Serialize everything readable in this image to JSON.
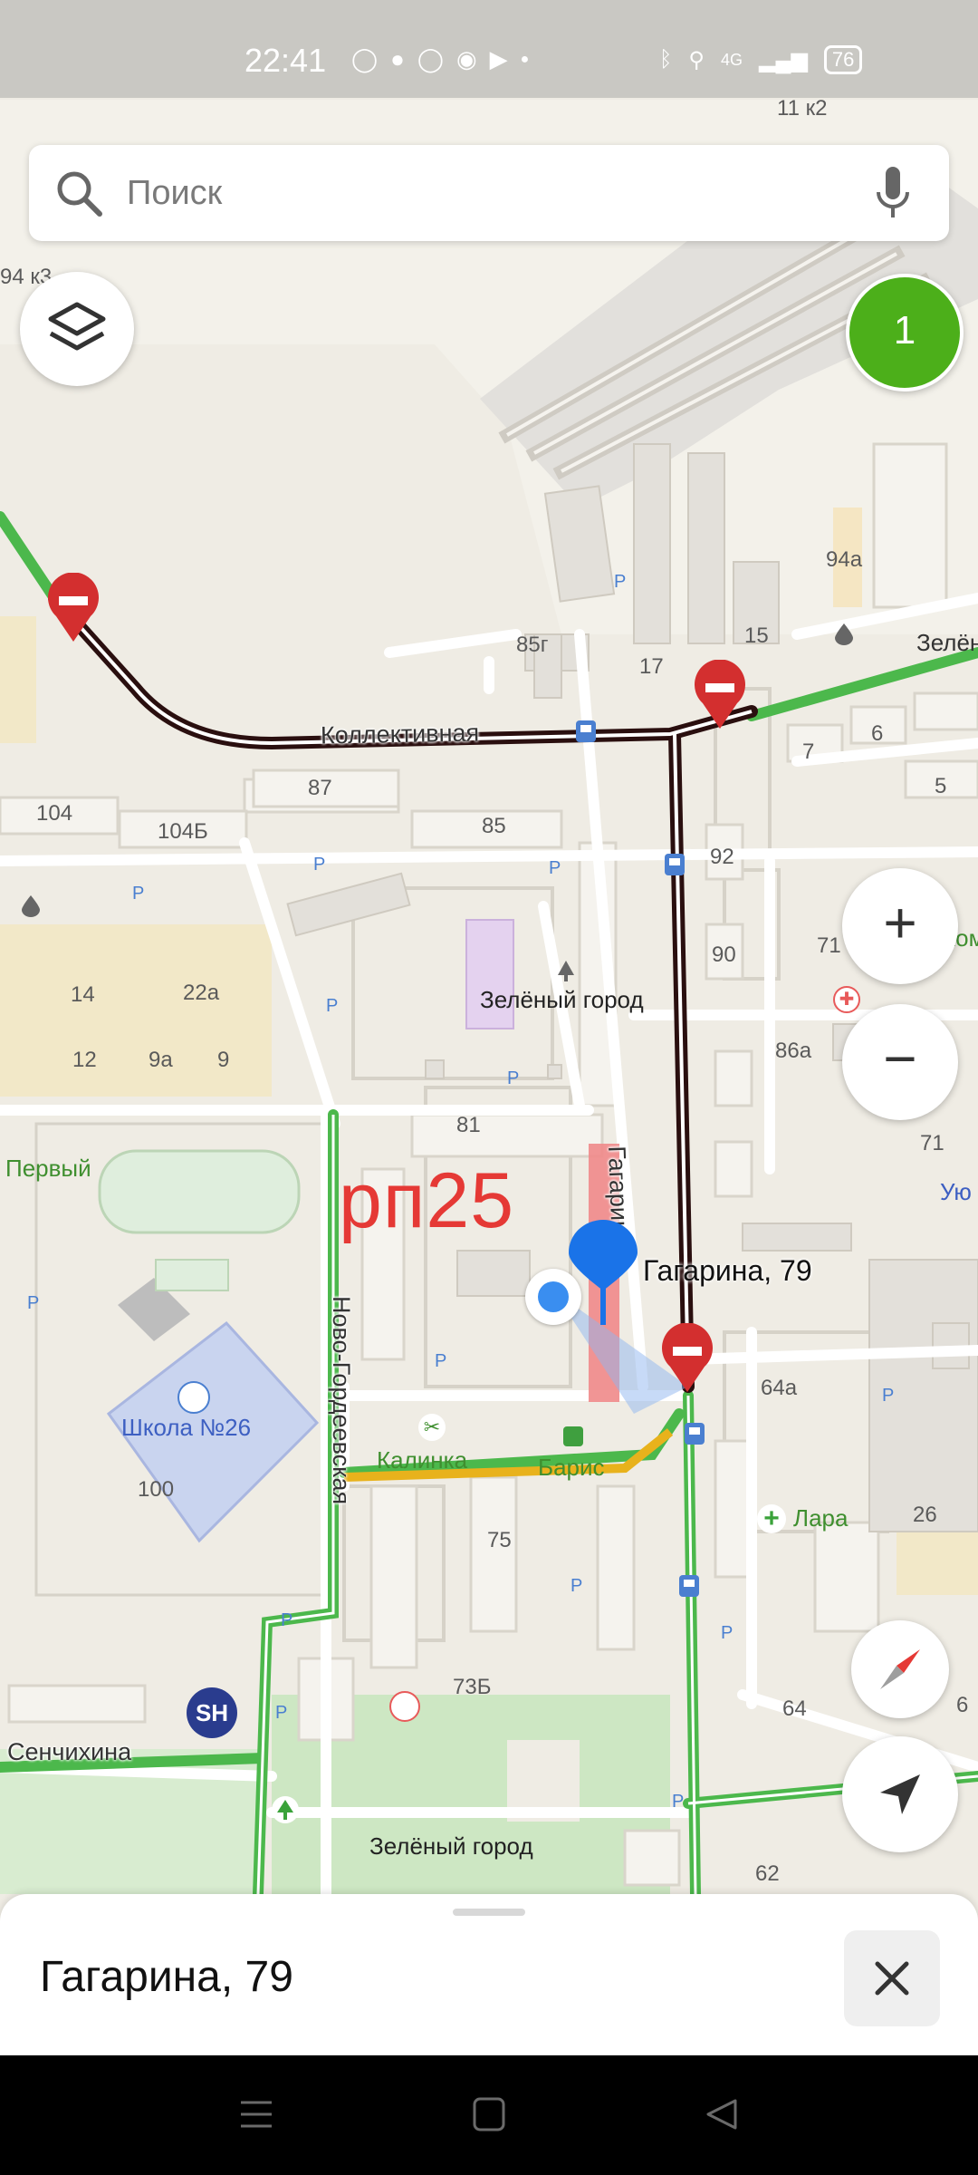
{
  "status_bar": {
    "time": "22:41",
    "network": "4G",
    "battery": "76",
    "icons": [
      "whatsapp-icon",
      "chat-icon",
      "viber-icon",
      "browser-icon",
      "youtube-icon",
      "dot-icon",
      "bluetooth-icon",
      "location-icon",
      "signal-icon",
      "signal-icon",
      "battery-icon"
    ]
  },
  "search": {
    "placeholder": "Поиск"
  },
  "badge": {
    "count": "1",
    "color": "#4caf1a"
  },
  "map": {
    "streets": {
      "kollektivnaya": "Коллективная",
      "gagarina": "Гагарина",
      "novo_gordeevskaya": "Ново-Гордеевская",
      "senchikhina": "Сенчихина"
    },
    "places": {
      "zeleny_gorod_1": "Зелёный город",
      "zeleny_gorod_2": "Зелёный город",
      "school": "Школа №26",
      "kalinka": "Калинка",
      "baris": "Барис",
      "lara": "Лара",
      "perviy": "Первый",
      "zelen_partial": "Зелён",
      "kom_partial": "Ком",
      "uyu_partial": "Ую"
    },
    "house_numbers": [
      "11 к2",
      "94 к3",
      "94а",
      "15",
      "85г",
      "17",
      "6",
      "7",
      "5",
      "104",
      "104Б",
      "87",
      "85",
      "92",
      "90",
      "71",
      "14",
      "22а",
      "12",
      "9а",
      "9",
      "86а",
      "71",
      "81",
      "64а",
      "100",
      "75",
      "26",
      "73Б",
      "64",
      "62",
      "6"
    ],
    "annotation": "рп25",
    "pin_label": "Гагарина, 79",
    "brand_badge": "SH"
  },
  "controls": {
    "zoom_in": "+",
    "zoom_out": "−"
  },
  "sheet": {
    "title": "Гагарина, 79"
  },
  "colors": {
    "traffic_green": "#4cb84c",
    "traffic_jam": "#2a0f0f",
    "traffic_yellow": "#e8b21c",
    "pin_blue": "#1a73e8",
    "annotation_red": "#e53935"
  }
}
